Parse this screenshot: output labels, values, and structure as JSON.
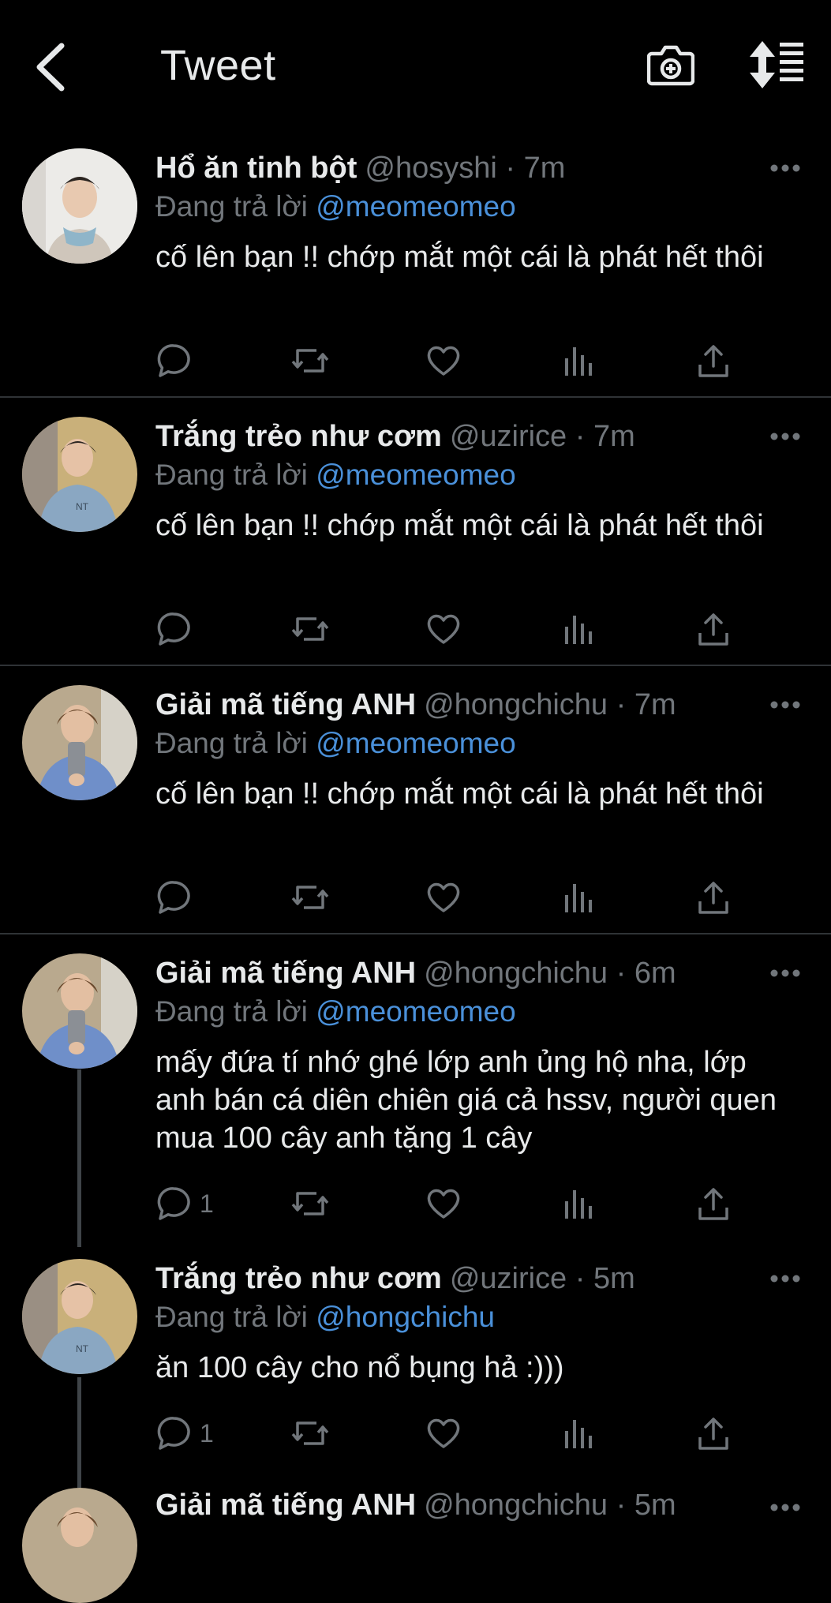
{
  "header": {
    "title": "Tweet",
    "back_icon": "chevron-left-icon",
    "camera_icon": "camera-plus-icon",
    "sort_icon": "sort-lines-icon"
  },
  "colors": {
    "background": "#000000",
    "text": "#e7e9ea",
    "muted": "#71767b",
    "mention": "#4a90d9",
    "divider": "#2f3336"
  },
  "tweets": [
    {
      "name": "Hổ ăn tinh bột",
      "handle": "@hosyshi",
      "time": "7m",
      "reply_prefix": "Đang trả lời",
      "reply_to": "@meomeomeo",
      "text": "cố lên bạn !! chớp mắt một cái là phát hết thôi",
      "reply_count": ""
    },
    {
      "name": "Trắng trẻo như cơm",
      "handle": "@uzirice",
      "time": "7m",
      "reply_prefix": "Đang trả lời",
      "reply_to": "@meomeomeo",
      "text": "cố lên bạn !! chớp mắt một cái là phát hết thôi",
      "reply_count": ""
    },
    {
      "name": "Giải mã tiếng ANH",
      "handle": "@hongchichu",
      "time": "7m",
      "reply_prefix": "Đang trả lời",
      "reply_to": "@meomeomeo",
      "text": "cố lên bạn !! chớp mắt một cái là phát hết thôi",
      "reply_count": ""
    },
    {
      "name": "Giải mã tiếng ANH",
      "handle": "@hongchichu",
      "time": "6m",
      "reply_prefix": "Đang trả lời",
      "reply_to": "@meomeomeo",
      "text": "mấy đứa tí nhớ ghé lớp anh ủng hộ nha, lớp anh bán cá diên chiên giá cả hssv, người quen mua 100 cây anh tặng 1 cây",
      "reply_count": "1"
    },
    {
      "name": "Trắng trẻo như cơm",
      "handle": "@uzirice",
      "time": "5m",
      "reply_prefix": "Đang trả lời",
      "reply_to": "@hongchichu",
      "text": "ăn 100 cây cho nổ bụng hả :)))",
      "reply_count": "1"
    },
    {
      "name": "Giải mã tiếng ANH",
      "handle": "@hongchichu",
      "time": "5m",
      "reply_prefix": "",
      "reply_to": "",
      "text": "",
      "reply_count": ""
    }
  ]
}
